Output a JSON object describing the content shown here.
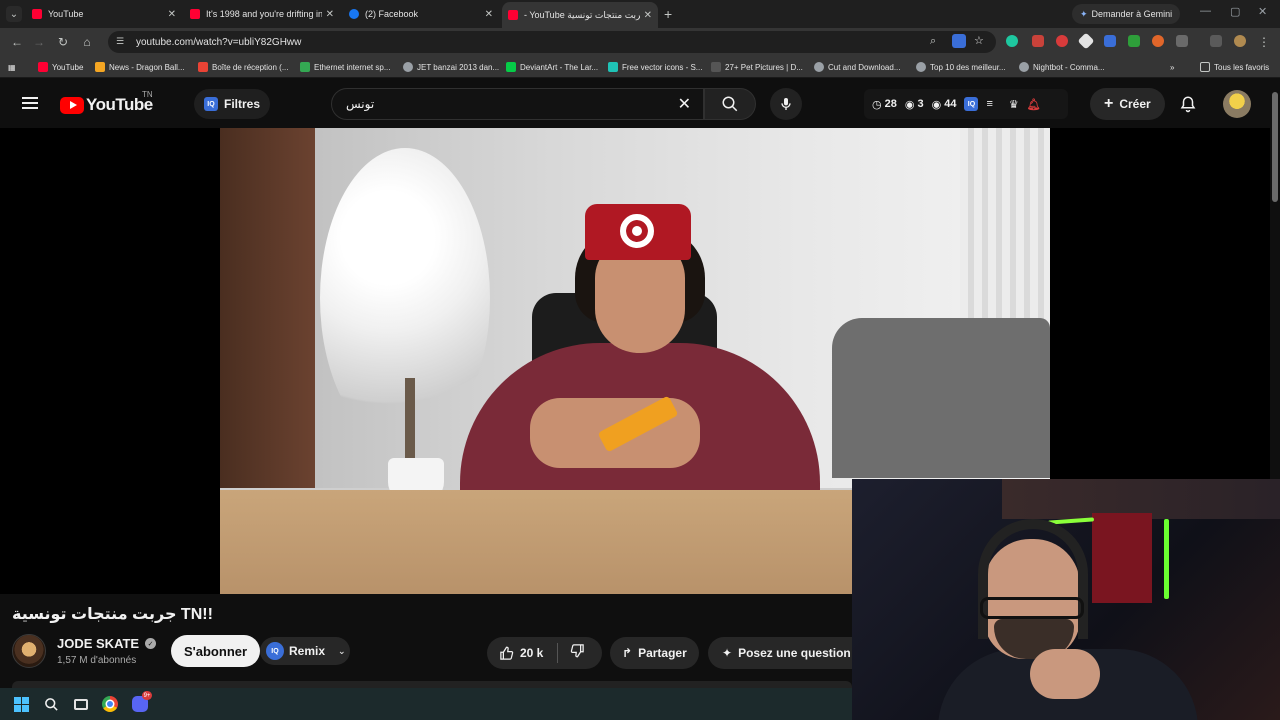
{
  "browser": {
    "tabs": [
      {
        "title": "YouTube",
        "favicon_color": "#ff0033",
        "active": false
      },
      {
        "title": "It's 1998 and you're drifting in",
        "favicon_color": "#ff0033",
        "active": false
      },
      {
        "title": "(2) Facebook",
        "favicon_color": "#1877f2",
        "active": false
      },
      {
        "title": "- YouTube جربت منتجات تونسية",
        "favicon_color": "#ff0033",
        "active": true
      }
    ],
    "new_tab": "+",
    "gemini_label": "Demander à Gemini",
    "url": "youtube.com/watch?v=ubliY82GHww",
    "bookmarks": [
      {
        "label": "YouTube",
        "color": "#ff0033"
      },
      {
        "label": "News - Dragon Ball...",
        "color": "#f5a623"
      },
      {
        "label": "Boîte de réception (...",
        "color": "#ea4335"
      },
      {
        "label": "Ethernet internet sp...",
        "color": "#34a853"
      },
      {
        "label": "JET banzai 2013 dan...",
        "color": "#9aa0a6"
      },
      {
        "label": "DeviantArt - The Lar...",
        "color": "#05cc47"
      },
      {
        "label": "Free vector icons - S...",
        "color": "#1fc3b6"
      },
      {
        "label": "27+ Pet Pictures | D...",
        "color": "#555555"
      },
      {
        "label": "Cut and Download...",
        "color": "#9aa0a6"
      },
      {
        "label": "Top 10 des meilleur...",
        "color": "#9aa0a6"
      },
      {
        "label": "Nightbot - Comma...",
        "color": "#9aa0a6"
      }
    ],
    "all_bookmarks": "Tous les favoris"
  },
  "youtube": {
    "logo_text": "YouTube",
    "country_code": "TN",
    "filters_label": "Filtres",
    "search_value": "تونس",
    "stats": {
      "watch_later": "28",
      "viewed": "3",
      "views": "44"
    },
    "create_label": "Créer"
  },
  "video": {
    "title": "جربت منتجات تونسية TN!!",
    "channel_name": "JODE SKATE",
    "subscribers": "1,57 M d'abonnés",
    "subscribe_label": "S'abonner",
    "remix_label": "Remix",
    "likes": "20 k",
    "share_label": "Partager",
    "ask_label": "Posez une question"
  },
  "taskbar": {
    "discord_badge": "9+"
  },
  "colors": {
    "youtube_red": "#ff0000",
    "background": "#0f0f0f",
    "chip": "#272727",
    "accent_blue": "#3a6ed8"
  }
}
